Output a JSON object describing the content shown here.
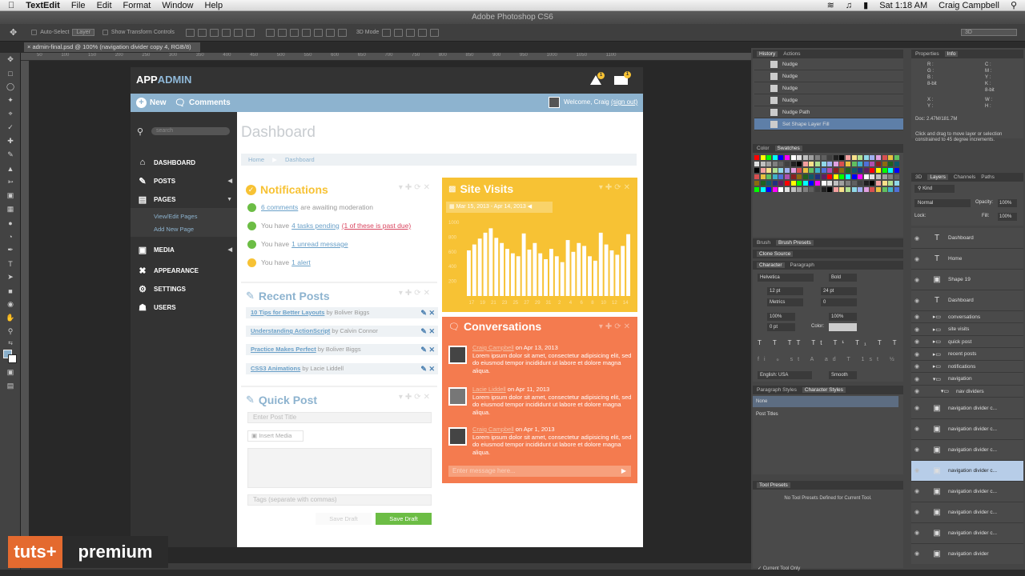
{
  "menubar": {
    "app": "TextEdit",
    "menus": [
      "File",
      "Edit",
      "Format",
      "Window",
      "Help"
    ],
    "clock": "Sat 1:18 AM",
    "user": "Craig Campbell"
  },
  "ps": {
    "window_title": "Adobe Photoshop CS6",
    "doc_tab": "admin-final.psd @ 100% (navigation divider copy 4, RGB/8)",
    "auto_select": "Auto-Select",
    "layer_select": "Layer",
    "transform": "Show Transform Controls",
    "mode3d": "3D Mode",
    "workspace": "3D",
    "ruler": "50 100 150 200 250 300 350 400 450 500 550 600 650 700 750 800 850 900 950 1000 1050 1100"
  },
  "app": {
    "logo_a": "APP",
    "logo_b": "ADMIN",
    "new_label": "New",
    "comments_label": "Comments",
    "welcome": "Welcome, Craig",
    "sign_out": "(sign out)",
    "search_placeholder": "search",
    "page_title": "Dashboard",
    "breadcrumb_home": "Home",
    "breadcrumb_current": "Dashboard",
    "alert_badge": "1",
    "mail_badge": "1"
  },
  "nav": [
    {
      "label": "DASHBOARD",
      "icon": "⌂"
    },
    {
      "label": "POSTS",
      "icon": "✎"
    },
    {
      "label": "PAGES",
      "icon": "▤"
    },
    {
      "label": "MEDIA",
      "icon": "▣"
    },
    {
      "label": "APPEARANCE",
      "icon": "✖"
    },
    {
      "label": "SETTINGS",
      "icon": "⚙"
    },
    {
      "label": "USERS",
      "icon": "☗"
    }
  ],
  "subnav": [
    "View/Edit Pages",
    "Add New Page"
  ],
  "notifications": {
    "title": "Notifications",
    "r1_link": "6 comments",
    "r1_text": "are awaiting moderation",
    "r2_a": "You have",
    "r2_link": "4 tasks pending",
    "r2_red": "(1 of these is past due)",
    "r3_a": "You have",
    "r3_link": "1 unread message",
    "r4_a": "You have",
    "r4_link": "1 alert"
  },
  "recent_posts": {
    "title": "Recent Posts",
    "items": [
      {
        "title": "10 Tips for Better Layouts",
        "by": "by Boliver Biggs"
      },
      {
        "title": "Understanding ActionScript",
        "by": "by Calvin Connor"
      },
      {
        "title": "Practice Makes Perfect",
        "by": "by Boliver Biggs"
      },
      {
        "title": "CSS3 Animations",
        "by": "by Lacie Liddell"
      }
    ]
  },
  "quick_post": {
    "title": "Quick Post",
    "title_placeholder": "Enter Post Title",
    "insert_media": "Insert Media",
    "tags_placeholder": "Tags (separate with commas)",
    "save_draft_disabled": "Save Draft",
    "save_draft": "Save Draft"
  },
  "site_visits": {
    "title": "Site Visits",
    "date_range": "Mar 15, 2013 - Apr 14, 2013"
  },
  "chart_data": {
    "type": "bar",
    "y_ticks": [
      "1000",
      "800",
      "600",
      "400",
      "200"
    ],
    "x_ticks": [
      "17",
      "19",
      "21",
      "23",
      "25",
      "27",
      "29",
      "31",
      "2",
      "4",
      "6",
      "8",
      "10",
      "12",
      "14"
    ],
    "values": [
      620,
      700,
      780,
      860,
      920,
      790,
      720,
      640,
      580,
      540,
      850,
      630,
      720,
      580,
      500,
      640,
      540,
      460,
      760,
      600,
      720,
      680,
      540,
      480,
      860,
      700,
      620,
      560,
      680,
      840
    ],
    "ylim": [
      0,
      1000
    ]
  },
  "conversations": {
    "title": "Conversations",
    "items": [
      {
        "who": "Craig Campbell",
        "date": "on Apr 13, 2013",
        "text": "Lorem ipsum dolor sit amet, consectetur adipisicing elit, sed do eiusmod tempor incididunt ut labore et dolore magna aliqua."
      },
      {
        "who": "Lacie Liddell",
        "date": "on Apr 11, 2013",
        "text": "Lorem ipsum dolor sit amet, consectetur adipisicing elit, sed do eiusmod tempor incididunt ut labore et dolore magna aliqua."
      },
      {
        "who": "Craig Campbell",
        "date": "on Apr 1, 2013",
        "text": "Lorem ipsum dolor sit amet, consectetur adipisicing elit, sed do eiusmod tempor incididunt ut labore et dolore magna aliqua."
      }
    ],
    "message_placeholder": "Enter message here..."
  },
  "history": {
    "tabs": [
      "History",
      "Actions"
    ],
    "items": [
      "Nudge",
      "Nudge",
      "Nudge",
      "Nudge",
      "Nudge Path",
      "Set Shape Layer Fill"
    ]
  },
  "properties": {
    "tabs": [
      "Properties",
      "Info"
    ],
    "r": "R :",
    "g": "G :",
    "b": "B :",
    "c": "C :",
    "m": "M :",
    "y": "Y :",
    "k": "K :",
    "bit8": "8-bit",
    "x": "X :",
    "yy": "Y :",
    "w": "W :",
    "h": "H :",
    "doc": "Doc: 2.47M/181.7M",
    "hint": "Click and drag to move layer or selection constrained to 45 degree increments."
  },
  "swatches_tabs": [
    "Color",
    "Swatches"
  ],
  "brush_tabs": [
    "Brush",
    "Brush Presets"
  ],
  "clone_source": "Clone Source",
  "character": {
    "tabs": [
      "Character",
      "Paragraph"
    ],
    "font": "Helvetica",
    "style": "Bold",
    "size": "12 pt",
    "leading": "24 pt",
    "kerning": "Metrics",
    "tracking": "0",
    "vscale": "100%",
    "hscale": "100%",
    "baseline": "0 pt",
    "color_label": "Color:",
    "language": "English: USA",
    "aa": "Smooth"
  },
  "styles": {
    "tabs": [
      "Paragraph Styles",
      "Character Styles"
    ],
    "items": [
      "None",
      "Post Titles"
    ]
  },
  "tool_presets": {
    "title": "Tool Presets",
    "empty": "No Tool Presets Defined for Current Tool.",
    "current_only": "Current Tool Only"
  },
  "layers": {
    "tabs": [
      "3D",
      "Layers",
      "Channels",
      "Paths"
    ],
    "kind": "Kind",
    "blend": "Normal",
    "opacity_label": "Opacity:",
    "opacity": "100%",
    "lock_label": "Lock:",
    "fill_label": "Fill:",
    "fill": "100%",
    "items": [
      {
        "name": "Dashboard",
        "type": "T"
      },
      {
        "name": "Home",
        "type": "T"
      },
      {
        "name": "Shape 19",
        "type": "▭"
      },
      {
        "name": "Dashboard",
        "type": "T"
      },
      {
        "name": "conversations",
        "type": "folder"
      },
      {
        "name": "site visits",
        "type": "folder"
      },
      {
        "name": "quick post",
        "type": "folder"
      },
      {
        "name": "recent posts",
        "type": "folder"
      },
      {
        "name": "notifications",
        "type": "folder"
      },
      {
        "name": "navigation",
        "type": "folder-open"
      },
      {
        "name": "nav dividers",
        "type": "folder-open"
      },
      {
        "name": "navigation divider c...",
        "type": "shape"
      },
      {
        "name": "navigation divider c...",
        "type": "shape"
      },
      {
        "name": "navigation divider c...",
        "type": "shape"
      },
      {
        "name": "navigation divider c...",
        "type": "shape",
        "selected": true
      },
      {
        "name": "navigation divider c...",
        "type": "shape"
      },
      {
        "name": "navigation divider c...",
        "type": "shape"
      },
      {
        "name": "navigation divider c...",
        "type": "shape"
      },
      {
        "name": "navigation divider",
        "type": "shape"
      }
    ]
  },
  "watermark": {
    "a": "tuts+",
    "b": "premium"
  },
  "colors": {
    "blue": "#8db3cf",
    "yellow": "#f7c234",
    "orange": "#f47b4f",
    "green": "#6cbd45",
    "dark": "#333333"
  }
}
